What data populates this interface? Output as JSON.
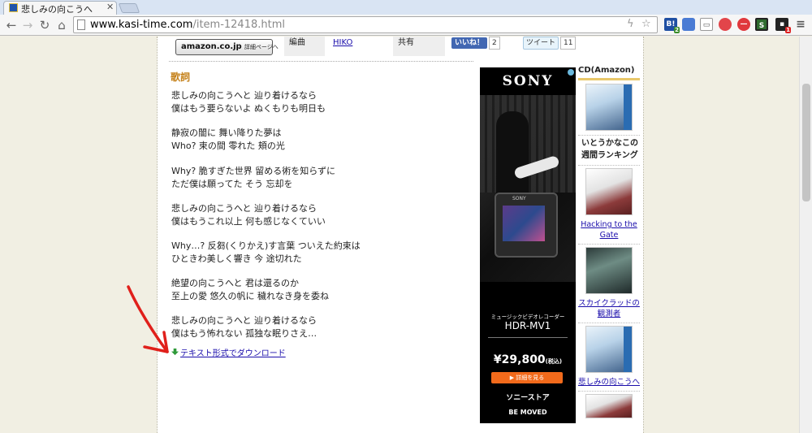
{
  "browser": {
    "tab_title": "悲しみの向こうへ　いとうかなこ",
    "url_host": "www.kasi-time.com",
    "url_path": "/item-12418.html",
    "ext_badges": [
      "2",
      "1"
    ]
  },
  "infobar": {
    "amazon_label": "amazon.co.jp",
    "amazon_sub": "詳細ページへ",
    "arranger_label": "編曲",
    "arranger_value": "HIKO",
    "share_label": "共有",
    "like_label": "いいね！",
    "like_count": "2",
    "tweet_label": "ツイート",
    "tweet_count": "11"
  },
  "lyrics": {
    "heading": "歌詞",
    "lines": [
      "悲しみの向こうへと 辿り着けるなら",
      "僕はもう要らないよ ぬくもりも明日も",
      "静寂の闇に 舞い降りた夢は",
      "Who? 束の間 零れた 頬の光",
      "Why? 脆すぎた世界 留める術を知らずに",
      "ただ僕は願ってた そう 忘却を",
      "悲しみの向こうへと 辿り着けるなら",
      "僕はもうこれ以上 何も感じなくていい",
      "Why…? 反芻(くりかえ)す言葉 ついえた約束は",
      "ひときわ美しく響き 今 途切れた",
      "絶望の向こうへと 君は還るのか",
      "至上の愛 悠久の帆に 穢れなき身を委ね",
      "悲しみの向こうへと 辿り着けるなら",
      "僕はもう怖れない 孤独な眠りさえ…"
    ],
    "download": "テキスト形式でダウンロード"
  },
  "ad": {
    "brand": "SONY",
    "camera_label": "SONY",
    "subtitle": "ミュージックビデオレコーダー",
    "model": "HDR-MV1",
    "price": "¥29,800",
    "tax": "(税込)",
    "cta": "▶ 詳細を見る",
    "store": "ソニーストア",
    "tagline": "BE MOVED"
  },
  "sidebar": {
    "cd_header": "CD(Amazon)",
    "ranking_header": "いとうかなこの週間ランキング",
    "ranking_items": [
      "Hacking to the Gate",
      "スカイクラッドの観測者",
      "悲しみの向こうへ"
    ]
  },
  "colors": {
    "heading_accent": "#c5811a",
    "link": "#1a0dab",
    "annotation_arrow": "#e0201b",
    "ad_cta": "#f26a1b"
  }
}
